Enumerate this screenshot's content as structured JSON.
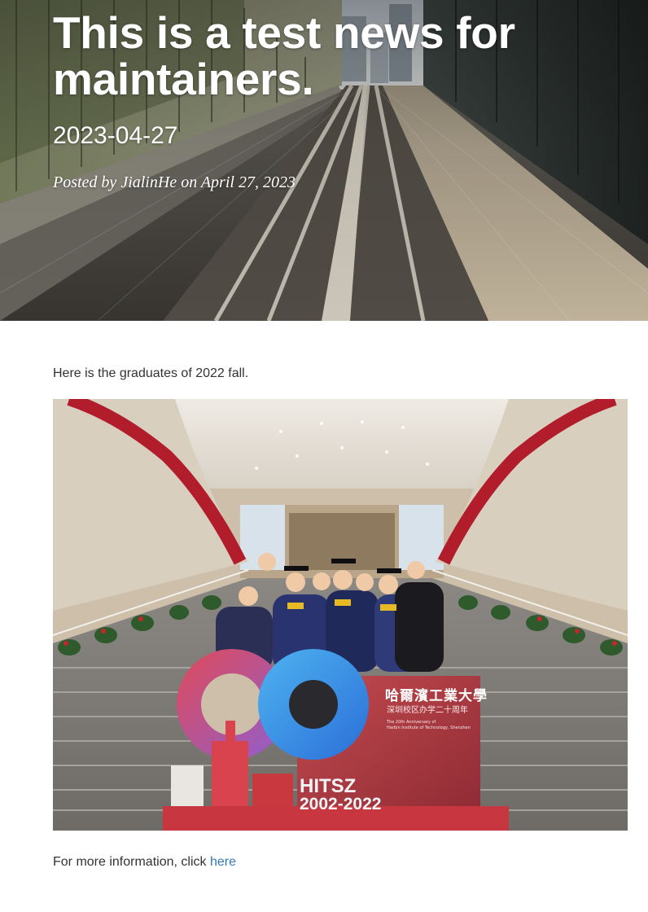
{
  "header": {
    "title": "This is a test news for maintainers.",
    "subtitle": "2023-04-27",
    "meta": {
      "prefix": "Posted by ",
      "author": "JialinHe",
      "middle": " on ",
      "date": "April 27, 2023"
    },
    "background_icon": "railway-tracks-image"
  },
  "article": {
    "intro": "Here is the graduates of 2022 fall.",
    "photo": {
      "icon": "graduation-group-photo",
      "sign_chinese_name": "哈爾濱工業大學",
      "sign_chinese_sub": "深圳校区办学二十周年",
      "sign_english_1": "The 20th Anniversary of",
      "sign_english_2": "Harbin Institute of Technology, Shenzhen",
      "logo_text": "HITSZ",
      "logo_years": "2002-2022"
    },
    "outro_prefix": "For more information, click ",
    "outro_link": "here"
  },
  "colors": {
    "link": "#337ab7",
    "body_text": "#333333",
    "title_text": "#ffffff"
  }
}
